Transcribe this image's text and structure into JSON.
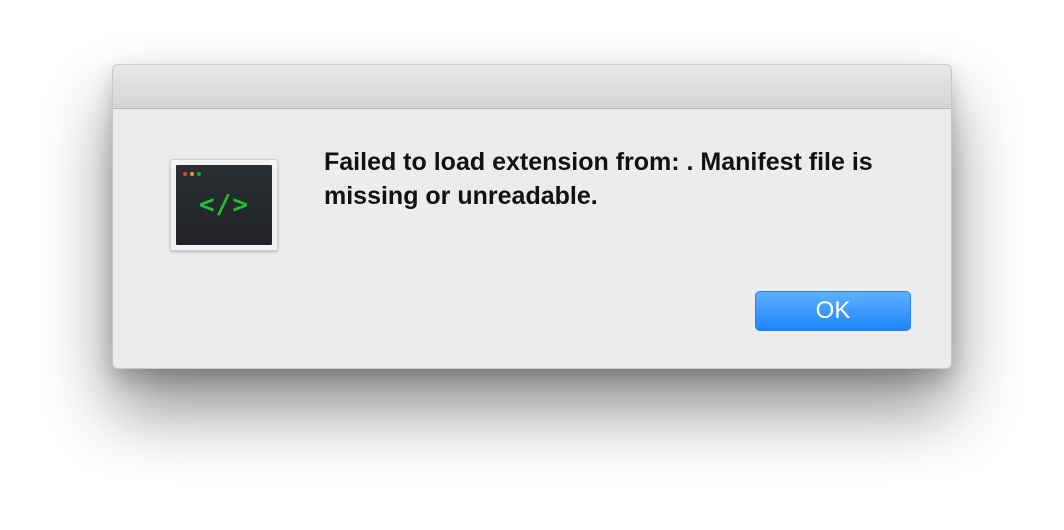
{
  "dialog": {
    "message": "Failed to load extension from: . Manifest file is missing or unreadable.",
    "ok_label": "OK",
    "icon": "terminal-code-icon",
    "icon_glyph": "</>"
  },
  "colors": {
    "dialog_background": "#ececec",
    "button_blue": "#1c85ff",
    "code_green": "#22c02a",
    "terminal_background": "#2b2e33"
  }
}
